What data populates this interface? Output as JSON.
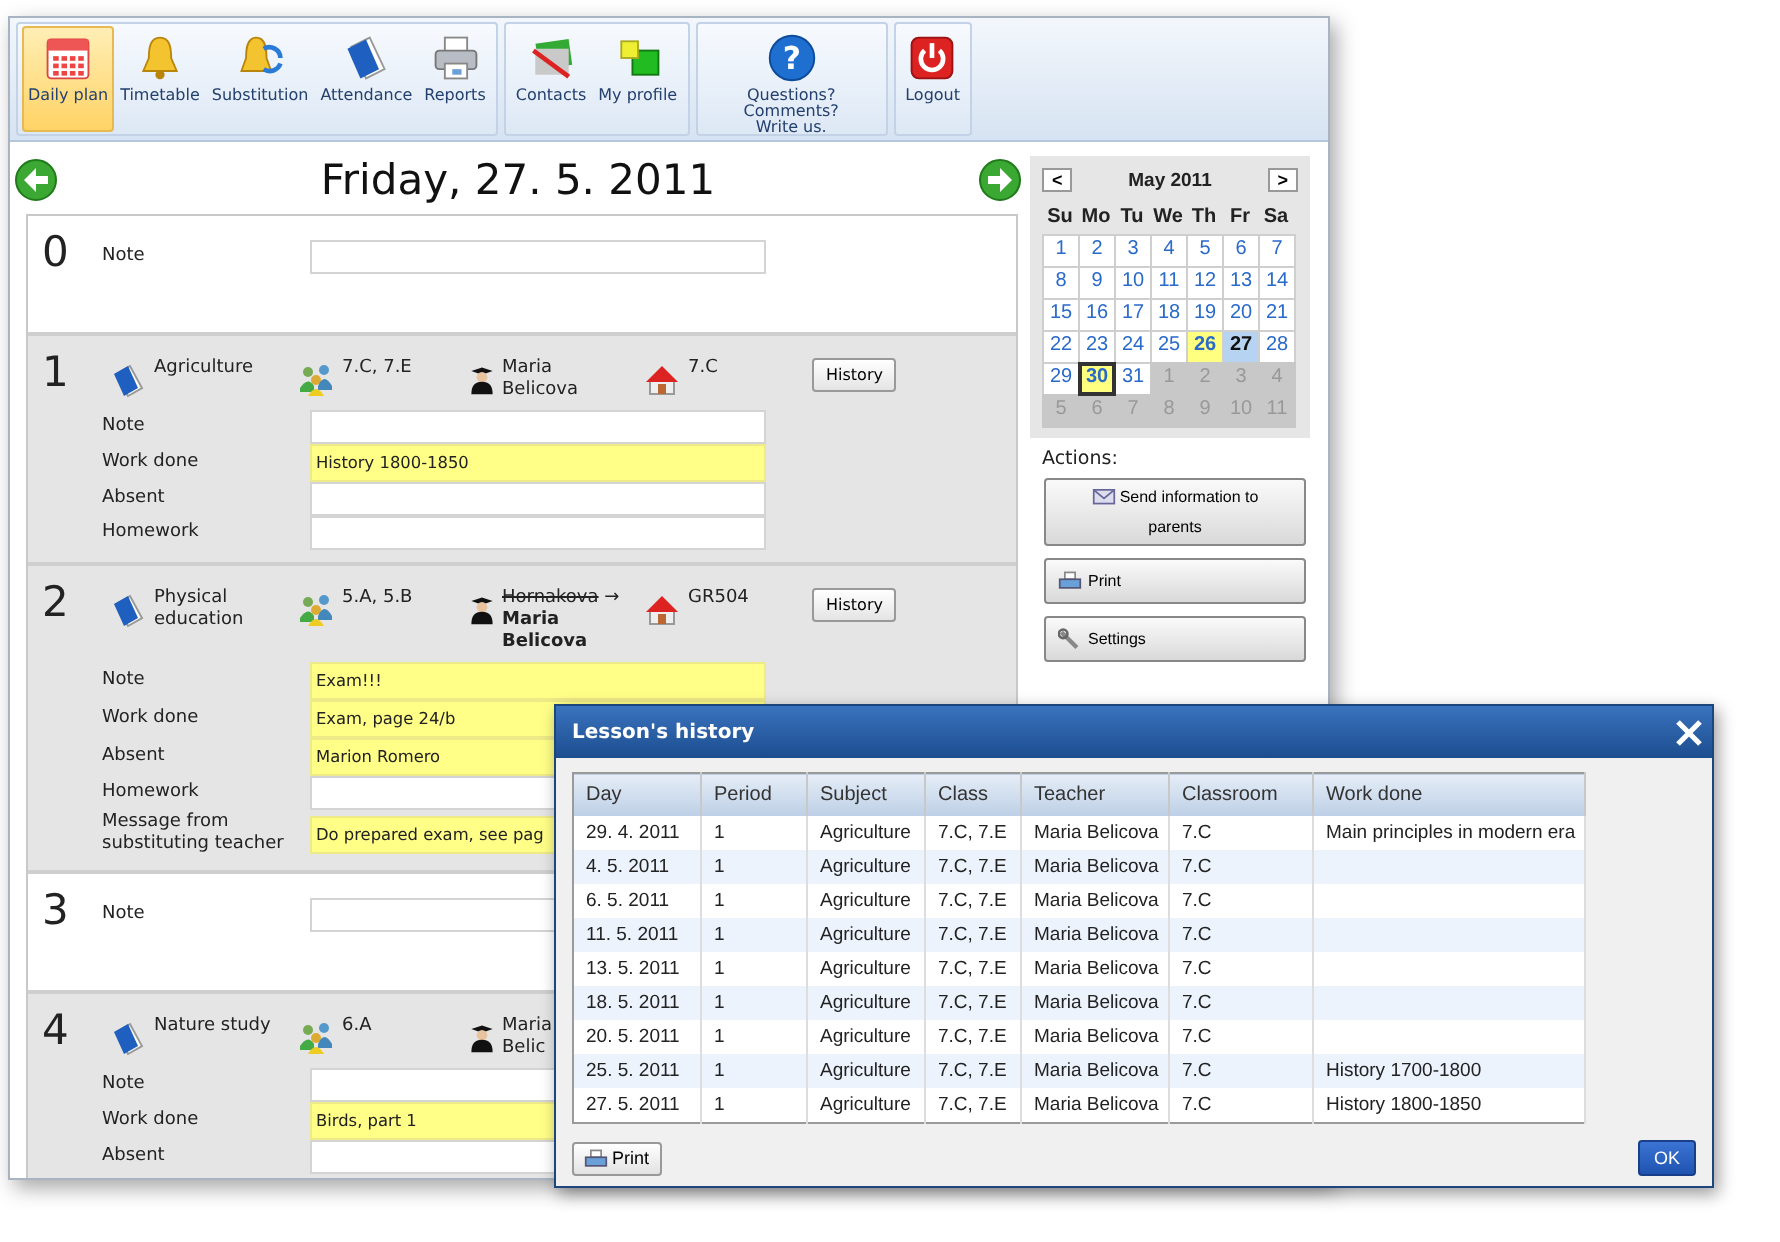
{
  "toolbar": [
    {
      "items": [
        {
          "label": "Daily plan",
          "kind": "calendar",
          "selected": true
        },
        {
          "label": "Timetable",
          "kind": "bell",
          "selected": false
        },
        {
          "label": "Substitution",
          "kind": "bell-arrows",
          "selected": false
        },
        {
          "label": "Attendance",
          "kind": "book",
          "selected": false
        },
        {
          "label": "Reports",
          "kind": "printer",
          "selected": false
        }
      ]
    },
    {
      "items": [
        {
          "label": "Contacts",
          "kind": "cards",
          "selected": false
        },
        {
          "label": "My profile",
          "kind": "cubes",
          "selected": false
        }
      ]
    },
    {
      "items": [
        {
          "label": "Questions? Comments? Write us.",
          "kind": "help",
          "glyph": "?",
          "selected": false
        }
      ]
    },
    {
      "items": [
        {
          "label": "Logout",
          "kind": "power",
          "selected": false
        }
      ]
    }
  ],
  "day_title": "Friday, 27. 5. 2011",
  "lessons": [
    {
      "number": "0",
      "kind": "free",
      "fields": [
        {
          "label": "Note"
        }
      ]
    },
    {
      "number": "1",
      "kind": "lesson",
      "subject": "Agriculture",
      "classes": "7.C, 7.E",
      "teacher": "Maria Belicova",
      "room": "7.C",
      "history_button": "History",
      "fields": [
        {
          "label": "Note"
        },
        {
          "label": "Work done",
          "value": "History 1800-1850"
        },
        {
          "label": "Absent"
        },
        {
          "label": "Homework"
        }
      ]
    },
    {
      "number": "2",
      "kind": "lesson",
      "subject": "Physical education",
      "classes": "5.A, 5.B",
      "original_teacher": "Hornakova",
      "substitution_arrow": "→",
      "teacher": "Maria Belicova",
      "room": "GR504",
      "history_button": "History",
      "fields": [
        {
          "label": "Note",
          "value": "Exam!!!"
        },
        {
          "label": "Work done",
          "value": "Exam, page 24/b"
        },
        {
          "label": "Absent",
          "value": "Marion Romero"
        },
        {
          "label": "Homework"
        },
        {
          "label": "Message from substituting teacher",
          "value": "Do prepared exam, see pag"
        }
      ]
    },
    {
      "number": "3",
      "kind": "free",
      "fields": [
        {
          "label": "Note"
        }
      ]
    },
    {
      "number": "4",
      "kind": "lesson",
      "subject": "Nature study",
      "classes": "6.A",
      "teacher": "Maria Belic",
      "fields": [
        {
          "label": "Note"
        },
        {
          "label": "Work done",
          "value": "Birds, part 1"
        },
        {
          "label": "Absent"
        }
      ]
    }
  ],
  "calendar": {
    "prev": "<",
    "next": ">",
    "month": "May 2011",
    "weekdays": [
      "Su",
      "Mo",
      "Tu",
      "We",
      "Th",
      "Fr",
      "Sa"
    ],
    "days": [
      {
        "d": "1",
        "kind": "day",
        "selected": false
      },
      {
        "d": "2",
        "kind": "day",
        "selected": false
      },
      {
        "d": "3",
        "kind": "day",
        "selected": false
      },
      {
        "d": "4",
        "kind": "day",
        "selected": false
      },
      {
        "d": "5",
        "kind": "day",
        "selected": false
      },
      {
        "d": "6",
        "kind": "day",
        "selected": false
      },
      {
        "d": "7",
        "kind": "day",
        "selected": false
      },
      {
        "d": "8",
        "kind": "day",
        "selected": false
      },
      {
        "d": "9",
        "kind": "day",
        "selected": false
      },
      {
        "d": "10",
        "kind": "day",
        "selected": false
      },
      {
        "d": "11",
        "kind": "day",
        "selected": false
      },
      {
        "d": "12",
        "kind": "day",
        "selected": false
      },
      {
        "d": "13",
        "kind": "day",
        "selected": false
      },
      {
        "d": "14",
        "kind": "day",
        "selected": false
      },
      {
        "d": "15",
        "kind": "day",
        "selected": false
      },
      {
        "d": "16",
        "kind": "day",
        "selected": false
      },
      {
        "d": "17",
        "kind": "day",
        "selected": false
      },
      {
        "d": "18",
        "kind": "day",
        "selected": false
      },
      {
        "d": "19",
        "kind": "day",
        "selected": false
      },
      {
        "d": "20",
        "kind": "day",
        "selected": false
      },
      {
        "d": "21",
        "kind": "day",
        "selected": false
      },
      {
        "d": "22",
        "kind": "day",
        "selected": false
      },
      {
        "d": "23",
        "kind": "day",
        "selected": false
      },
      {
        "d": "24",
        "kind": "day",
        "selected": false
      },
      {
        "d": "25",
        "kind": "day",
        "selected": false
      },
      {
        "d": "26",
        "kind": "marked",
        "selected": false
      },
      {
        "d": "27",
        "kind": "day",
        "selected": true
      },
      {
        "d": "28",
        "kind": "day",
        "selected": false
      },
      {
        "d": "29",
        "kind": "day",
        "selected": false
      },
      {
        "d": "30",
        "kind": "today",
        "selected": false
      },
      {
        "d": "31",
        "kind": "day",
        "selected": false
      },
      {
        "d": "1",
        "kind": "other",
        "selected": false
      },
      {
        "d": "2",
        "kind": "other",
        "selected": false
      },
      {
        "d": "3",
        "kind": "other",
        "selected": false
      },
      {
        "d": "4",
        "kind": "other",
        "selected": false
      },
      {
        "d": "5",
        "kind": "other",
        "selected": false
      },
      {
        "d": "6",
        "kind": "other",
        "selected": false
      },
      {
        "d": "7",
        "kind": "other",
        "selected": false
      },
      {
        "d": "8",
        "kind": "other",
        "selected": false
      },
      {
        "d": "9",
        "kind": "other",
        "selected": false
      },
      {
        "d": "10",
        "kind": "other",
        "selected": false
      },
      {
        "d": "11",
        "kind": "other",
        "selected": false
      }
    ]
  },
  "actions_label": "Actions:",
  "actions": [
    {
      "label": "Send information to parents",
      "kind": "mail"
    },
    {
      "label": "Print",
      "kind": "print"
    },
    {
      "label": "Settings",
      "kind": "wrench"
    }
  ],
  "dialog": {
    "title": "Lesson's history",
    "columns": [
      "Day",
      "Period",
      "Subject",
      "Class",
      "Teacher",
      "Classroom",
      "Work done"
    ],
    "rows": [
      {
        "day": "29. 4. 2011",
        "period": "1",
        "subject": "Agriculture",
        "class": "7.C, 7.E",
        "teacher": "Maria Belicova",
        "classroom": "7.C",
        "work_done": "Main principles in modern era"
      },
      {
        "day": "4. 5. 2011",
        "period": "1",
        "subject": "Agriculture",
        "class": "7.C, 7.E",
        "teacher": "Maria Belicova",
        "classroom": "7.C"
      },
      {
        "day": "6. 5. 2011",
        "period": "1",
        "subject": "Agriculture",
        "class": "7.C, 7.E",
        "teacher": "Maria Belicova",
        "classroom": "7.C"
      },
      {
        "day": "11. 5. 2011",
        "period": "1",
        "subject": "Agriculture",
        "class": "7.C, 7.E",
        "teacher": "Maria Belicova",
        "classroom": "7.C"
      },
      {
        "day": "13. 5. 2011",
        "period": "1",
        "subject": "Agriculture",
        "class": "7.C, 7.E",
        "teacher": "Maria Belicova",
        "classroom": "7.C"
      },
      {
        "day": "18. 5. 2011",
        "period": "1",
        "subject": "Agriculture",
        "class": "7.C, 7.E",
        "teacher": "Maria Belicova",
        "classroom": "7.C"
      },
      {
        "day": "20. 5. 2011",
        "period": "1",
        "subject": "Agriculture",
        "class": "7.C, 7.E",
        "teacher": "Maria Belicova",
        "classroom": "7.C"
      },
      {
        "day": "25. 5. 2011",
        "period": "1",
        "subject": "Agriculture",
        "class": "7.C, 7.E",
        "teacher": "Maria Belicova",
        "classroom": "7.C",
        "work_done": "History 1700-1800"
      },
      {
        "day": "27. 5. 2011",
        "period": "1",
        "subject": "Agriculture",
        "class": "7.C, 7.E",
        "teacher": "Maria Belicova",
        "classroom": "7.C",
        "work_done": "History 1800-1850"
      }
    ],
    "print_button": "Print",
    "ok_button": "OK"
  }
}
